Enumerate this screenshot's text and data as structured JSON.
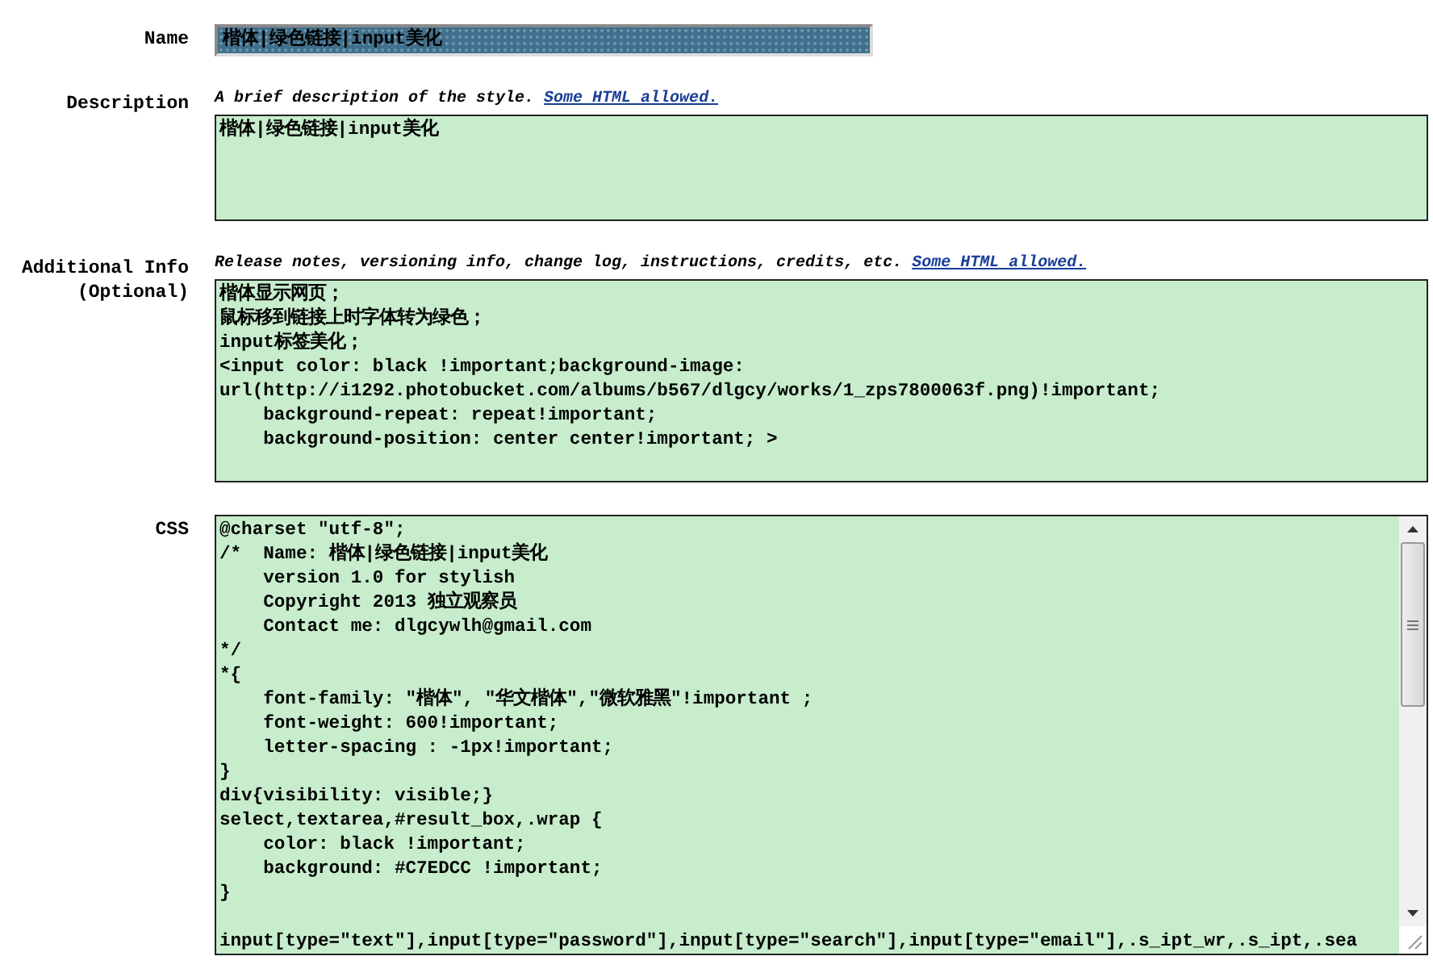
{
  "fields": [
    {
      "kind": "input",
      "label": "Name",
      "value": "楷体|绿色链接|input美化"
    },
    {
      "kind": "textarea",
      "label": "Description",
      "hint": "A brief description of the style.",
      "link": "Some HTML allowed.",
      "lines": [
        "楷体|绿色链接|input美化"
      ]
    },
    {
      "kind": "textarea",
      "label": "Additional Info",
      "label_note": "(Optional)",
      "hint": "Release notes, versioning info, change log, instructions, credits, etc.",
      "link": "Some HTML allowed.",
      "lines": [
        "楷体显示网页；",
        "鼠标移到链接上时字体转为绿色；",
        "input标签美化；",
        "<input color: black !important;background-image:",
        "url(http://i1292.photobucket.com/albums/b567/dlgcy/works/1_zps7800063f.png)!important;",
        "    background-repeat: repeat!important;",
        "    background-position: center center!important; >"
      ]
    },
    {
      "kind": "code",
      "label": "CSS",
      "lines": [
        "@charset \"utf-8\";",
        "/*  Name: 楷体|绿色链接|input美化",
        "    version 1.0 for stylish",
        "    Copyright 2013 独立观察员",
        "    Contact me: dlgcywlh@gmail.com",
        "*/",
        "*{",
        "    font-family: \"楷体\", \"华文楷体\",\"微软雅黑\"!important ;",
        "    font-weight: 600!important;",
        "    letter-spacing : -1px!important;",
        "}",
        "div{visibility: visible;}",
        "select,textarea,#result_box,.wrap {",
        "    color: black !important;",
        "    background: #C7EDCC !important;",
        "}"
      ],
      "tail": "input[type=\"text\"],input[type=\"password\"],input[type=\"search\"],input[type=\"email\"],.s_ipt_wr,.s_ipt,.sea"
    }
  ]
}
